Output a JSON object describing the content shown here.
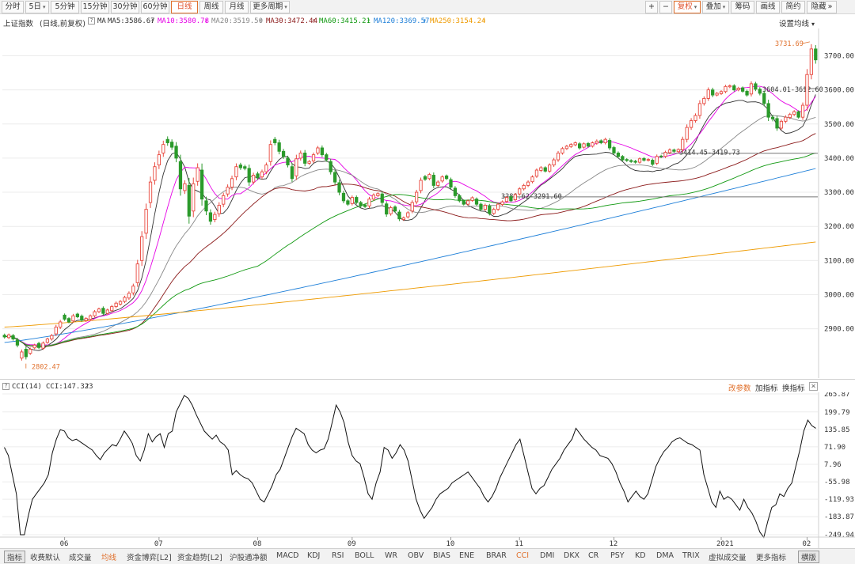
{
  "toolbar": {
    "left_buttons": [
      {
        "label": "分时",
        "active": false
      },
      {
        "label": "5日",
        "active": false,
        "dropdown": true
      },
      {
        "label": "5分钟",
        "active": false
      },
      {
        "label": "15分钟",
        "active": false
      },
      {
        "label": "30分钟",
        "active": false
      },
      {
        "label": "60分钟",
        "active": false
      },
      {
        "label": "日线",
        "active": true
      },
      {
        "label": "周线",
        "active": false
      },
      {
        "label": "月线",
        "active": false
      },
      {
        "label": "更多周期",
        "active": false,
        "dropdown": true
      }
    ],
    "right_buttons": [
      {
        "label": "+",
        "active": false
      },
      {
        "label": "−",
        "active": false
      },
      {
        "label": "复权",
        "active": true,
        "dropdown": true
      },
      {
        "label": "叠加",
        "active": false,
        "dropdown": true
      },
      {
        "label": "筹码",
        "active": false
      },
      {
        "label": "画线",
        "active": false
      },
      {
        "label": "简约",
        "active": false
      },
      {
        "label": "隐藏",
        "active": false,
        "suffix": "»"
      }
    ]
  },
  "info": {
    "title": "上证指数",
    "subtitle": "(日线,前复权)",
    "ma_label": "MA",
    "ma_items": [
      {
        "text": "MA5:3586.67",
        "color": "#333333"
      },
      {
        "text": "MA10:3580.78",
        "color": "#e600e6"
      },
      {
        "text": "MA20:3519.50",
        "color": "#888888"
      },
      {
        "text": "MA30:3472.44",
        "color": "#8b1a1a"
      },
      {
        "text": "MA60:3415.21",
        "color": "#119911"
      },
      {
        "text": "MA120:3369.57",
        "color": "#1e7fd8"
      },
      {
        "text": "MA250:3154.24",
        "color": "#ee9a00"
      }
    ],
    "arrow": "↑",
    "settings_label": "设置均线",
    "settings_caret": "▾"
  },
  "chart_data": [
    {
      "type": "candlestick",
      "title": "上证指数",
      "period": "日线",
      "adjustment": "前复权",
      "x_tick_labels": [
        {
          "label": "06",
          "index": 14
        },
        {
          "label": "07",
          "index": 36
        },
        {
          "label": "08",
          "index": 59
        },
        {
          "label": "09",
          "index": 81
        },
        {
          "label": "10",
          "index": 104
        },
        {
          "label": "11",
          "index": 120
        },
        {
          "label": "12",
          "index": 142
        },
        {
          "label": "2021",
          "index": 167
        },
        {
          "label": "02",
          "index": 187
        }
      ],
      "ylim": [
        2760,
        3780
      ],
      "y_ticks": [
        2900,
        3000,
        3100,
        3200,
        3300,
        3400,
        3500,
        3600,
        3700
      ],
      "moving_averages": [
        {
          "name": "MA5",
          "value": 3586.67,
          "color": "#333333"
        },
        {
          "name": "MA10",
          "value": 3580.78,
          "color": "#e600e6"
        },
        {
          "name": "MA20",
          "value": 3519.5,
          "color": "#888888"
        },
        {
          "name": "MA30",
          "value": 3472.44,
          "color": "#8b1a1a"
        },
        {
          "name": "MA60",
          "value": 3415.21,
          "color": "#119911"
        },
        {
          "name": "MA120",
          "value": 3369.57,
          "color": "#1e7fd8"
        },
        {
          "name": "MA250",
          "value": 3154.24,
          "color": "#ee9a00"
        }
      ],
      "annotations": [
        {
          "text": "3731.69",
          "value": 3731.69,
          "kind": "high"
        },
        {
          "text": "2802.47",
          "value": 2802.47,
          "kind": "low"
        },
        {
          "text": "3604.01-3612.60",
          "value": 3604.01,
          "kind": "range"
        },
        {
          "text": "3414.45-3419.73",
          "value": 3414.45,
          "kind": "range"
        },
        {
          "text": "3286.62-3291.60",
          "value": 3286.62,
          "kind": "range"
        }
      ],
      "closes": [
        2876,
        2882,
        2870,
        2852,
        2832,
        2818,
        2840,
        2852,
        2845,
        2858,
        2870,
        2880,
        2905,
        2920,
        2928,
        2920,
        2938,
        2935,
        2925,
        2930,
        2938,
        2950,
        2958,
        2945,
        2955,
        2965,
        2975,
        2980,
        2992,
        3004,
        3025,
        3090,
        3170,
        3250,
        3330,
        3375,
        3410,
        3440,
        3445,
        3432,
        3400,
        3310,
        3325,
        3230,
        3325,
        3372,
        3280,
        3245,
        3215,
        3235,
        3262,
        3290,
        3315,
        3340,
        3375,
        3372,
        3370,
        3330,
        3350,
        3342,
        3360,
        3380,
        3440,
        3445,
        3420,
        3405,
        3380,
        3340,
        3398,
        3415,
        3385,
        3390,
        3410,
        3430,
        3410,
        3395,
        3360,
        3330,
        3300,
        3275,
        3265,
        3285,
        3270,
        3260,
        3258,
        3280,
        3292,
        3296,
        3270,
        3236,
        3255,
        3245,
        3222,
        3225,
        3240,
        3270,
        3300,
        3335,
        3338,
        3352,
        3320,
        3330,
        3345,
        3340,
        3315,
        3290,
        3275,
        3265,
        3275,
        3284,
        3265,
        3250,
        3262,
        3238,
        3250,
        3265,
        3272,
        3285,
        3275,
        3293,
        3310,
        3320,
        3330,
        3345,
        3365,
        3372,
        3362,
        3380,
        3395,
        3415,
        3428,
        3435,
        3440,
        3445,
        3430,
        3442,
        3435,
        3445,
        3450,
        3445,
        3455,
        3430,
        3415,
        3405,
        3395,
        3393,
        3390,
        3388,
        3398,
        3394,
        3396,
        3382,
        3405,
        3404,
        3417,
        3424,
        3420,
        3425,
        3455,
        3490,
        3510,
        3525,
        3560,
        3575,
        3600,
        3585,
        3590,
        3595,
        3610,
        3612,
        3600,
        3605,
        3596,
        3585,
        3618,
        3602,
        3590,
        3560,
        3520,
        3515,
        3488,
        3508,
        3520,
        3528,
        3536,
        3520,
        3555,
        3645,
        3720,
        3688
      ],
      "open_offsets": [
        5,
        -8,
        10,
        15,
        -18,
        22,
        -12,
        -8,
        12,
        -15,
        -10,
        -10,
        -20,
        -15,
        12,
        10,
        -15,
        8,
        12,
        -6,
        -10,
        -12,
        -8,
        15,
        -10,
        -12,
        -10,
        -8,
        -12,
        -14,
        -20,
        -55,
        -70,
        -70,
        -60,
        -40,
        -30,
        -25,
        10,
        15,
        35,
        80,
        -20,
        90,
        -80,
        -40,
        85,
        30,
        25,
        -15,
        -25,
        -25,
        -20,
        -25,
        -30,
        8,
        5,
        40,
        -20,
        12,
        -15,
        -20,
        -50,
        10,
        25,
        15,
        20,
        35,
        -50,
        -15,
        30,
        -5,
        -18,
        -15,
        20,
        15,
        30,
        28,
        28,
        22,
        10,
        -18,
        15,
        10,
        5,
        -20,
        -12,
        -6,
        25,
        30,
        -18,
        12,
        20,
        -5,
        -12,
        -25,
        -28,
        -30,
        8,
        -12,
        30,
        -10,
        -12,
        8,
        22,
        22,
        15,
        10,
        -10,
        -8,
        15,
        15,
        -12,
        22,
        -12,
        -15,
        -8,
        -12,
        12,
        -15,
        -15,
        -10,
        -10,
        -14,
        -18,
        -8,
        10,
        -18,
        -15,
        -20,
        -13,
        -7,
        -6,
        -6,
        12,
        -10,
        8,
        -10,
        -6,
        6,
        -10,
        22,
        16,
        10,
        10,
        3,
        3,
        3,
        -10,
        5,
        -2,
        12,
        -20,
        2,
        -12,
        -8,
        4,
        -6,
        -30,
        -35,
        -20,
        -15,
        -35,
        -15,
        -25,
        15,
        -5,
        -6,
        -15,
        -3,
        12,
        -5,
        10,
        11,
        -30,
        16,
        12,
        30,
        40,
        5,
        28,
        -20,
        -12,
        -9,
        -8,
        16,
        -35,
        -90,
        -75,
        32
      ],
      "wick_ranges": [
        12,
        10,
        12,
        16,
        18,
        20,
        12,
        10,
        12,
        12,
        10,
        12,
        16,
        15,
        12,
        10,
        14,
        10,
        12,
        10,
        10,
        12,
        10,
        14,
        10,
        12,
        12,
        10,
        12,
        14,
        18,
        30,
        40,
        42,
        40,
        32,
        30,
        28,
        22,
        20,
        30,
        50,
        25,
        55,
        45,
        32,
        48,
        30,
        25,
        20,
        22,
        22,
        20,
        22,
        24,
        16,
        14,
        28,
        18,
        16,
        16,
        18,
        30,
        18,
        22,
        18,
        18,
        24,
        30,
        18,
        22,
        12,
        16,
        14,
        18,
        14,
        20,
        20,
        22,
        18,
        12,
        14,
        14,
        12,
        10,
        16,
        12,
        10,
        18,
        20,
        14,
        12,
        16,
        10,
        12,
        16,
        18,
        20,
        12,
        12,
        20,
        12,
        12,
        10,
        15,
        15,
        12,
        10,
        10,
        10,
        12,
        12,
        12,
        15,
        12,
        12,
        10,
        12,
        10,
        12,
        12,
        12,
        12,
        12,
        12,
        12,
        10,
        12,
        14,
        15,
        12,
        10,
        10,
        10,
        12,
        10,
        10,
        10,
        12,
        10,
        12,
        16,
        12,
        12,
        10,
        10,
        10,
        10,
        10,
        10,
        10,
        12,
        14,
        10,
        12,
        12,
        10,
        10,
        20,
        22,
        18,
        15,
        24,
        15,
        18,
        16,
        10,
        10,
        12,
        10,
        12,
        10,
        10,
        12,
        18,
        14,
        15,
        20,
        28,
        18,
        20,
        14,
        14,
        12,
        12,
        10,
        20,
        40,
        35,
        28
      ]
    },
    {
      "type": "line",
      "title": "CCI(14)",
      "indicator": "CCI",
      "series_label": "CCI:147.323",
      "value_label": "147.323",
      "y_ticks": [
        265.87,
        199.79,
        135.85,
        71.9,
        7.96,
        -55.98,
        -119.93,
        -183.87,
        -249.94
      ],
      "ylim": [
        -249.94,
        265.87
      ],
      "values": [
        70,
        40,
        -30,
        -100,
        -250,
        -250,
        -180,
        -120,
        -100,
        -80,
        -60,
        -30,
        50,
        100,
        135,
        130,
        105,
        95,
        100,
        90,
        80,
        70,
        60,
        40,
        25,
        50,
        65,
        80,
        75,
        100,
        130,
        110,
        85,
        40,
        20,
        60,
        120,
        90,
        110,
        120,
        70,
        120,
        130,
        200,
        230,
        260,
        250,
        225,
        190,
        160,
        130,
        115,
        100,
        115,
        90,
        80,
        60,
        -30,
        -15,
        -30,
        -40,
        -45,
        -60,
        -90,
        -120,
        -130,
        -100,
        -70,
        -30,
        -10,
        30,
        70,
        110,
        140,
        130,
        120,
        80,
        60,
        50,
        60,
        65,
        100,
        160,
        225,
        200,
        160,
        90,
        40,
        20,
        10,
        -40,
        -100,
        -120,
        -60,
        -20,
        70,
        60,
        30,
        50,
        80,
        60,
        20,
        -50,
        -120,
        -160,
        -190,
        -170,
        -150,
        -120,
        -100,
        -90,
        -80,
        -60,
        -50,
        -40,
        -30,
        -20,
        -40,
        -60,
        -80,
        -110,
        -130,
        -110,
        -80,
        -40,
        -10,
        20,
        50,
        80,
        100,
        40,
        -20,
        -80,
        -100,
        -80,
        -70,
        -40,
        -10,
        10,
        30,
        60,
        80,
        100,
        140,
        120,
        100,
        85,
        70,
        60,
        40,
        35,
        30,
        10,
        -20,
        -60,
        -90,
        -130,
        -110,
        -90,
        -110,
        -120,
        -100,
        -50,
        0,
        30,
        55,
        70,
        90,
        100,
        105,
        95,
        85,
        80,
        70,
        60,
        -30,
        -80,
        -130,
        -150,
        -90,
        -120,
        -110,
        -120,
        -140,
        -160,
        -120,
        -150,
        -170,
        -200,
        -240,
        -260,
        -200,
        -150,
        -140,
        -100,
        -110,
        -80,
        -60,
        0,
        60,
        130,
        170,
        150,
        140
      ]
    }
  ],
  "cci_panel": {
    "title": "CCI(14)",
    "value_label": "CCI:147.323",
    "arrow": "↑",
    "right_links": [
      {
        "label": "改参数",
        "color": "#e0702c"
      },
      {
        "label": "加指标",
        "color": "#333333"
      },
      {
        "label": "换指标",
        "color": "#333333"
      }
    ],
    "close_label": "×"
  },
  "bottom_tabs": [
    {
      "label": "指标",
      "boxed": true
    },
    {
      "label": "收费默认"
    },
    {
      "label": "成交量"
    },
    {
      "label": "均线",
      "active": true
    },
    {
      "label": "资金博弈[L2]"
    },
    {
      "label": "资金趋势[L2]"
    },
    {
      "label": "沪股通净额"
    },
    {
      "label": "MACD"
    },
    {
      "label": "KDJ"
    },
    {
      "label": "RSI"
    },
    {
      "label": "BOLL"
    },
    {
      "label": "WR"
    },
    {
      "label": "OBV"
    },
    {
      "label": "BIAS"
    },
    {
      "label": "ENE"
    },
    {
      "label": "BRAR"
    },
    {
      "label": "CCI",
      "active": true
    },
    {
      "label": "DMI"
    },
    {
      "label": "DKX"
    },
    {
      "label": "CR"
    },
    {
      "label": "PSY"
    },
    {
      "label": "KD"
    },
    {
      "label": "DMA"
    },
    {
      "label": "TRIX"
    },
    {
      "label": "虚拟成交量"
    },
    {
      "label": "更多指标"
    },
    {
      "label": "横版",
      "boxed": true
    }
  ],
  "colors": {
    "up": "#e8473d",
    "down": "#2b9a2b",
    "grid": "#ececec",
    "axis_text": "#333333",
    "annotation": "#e0702c"
  }
}
